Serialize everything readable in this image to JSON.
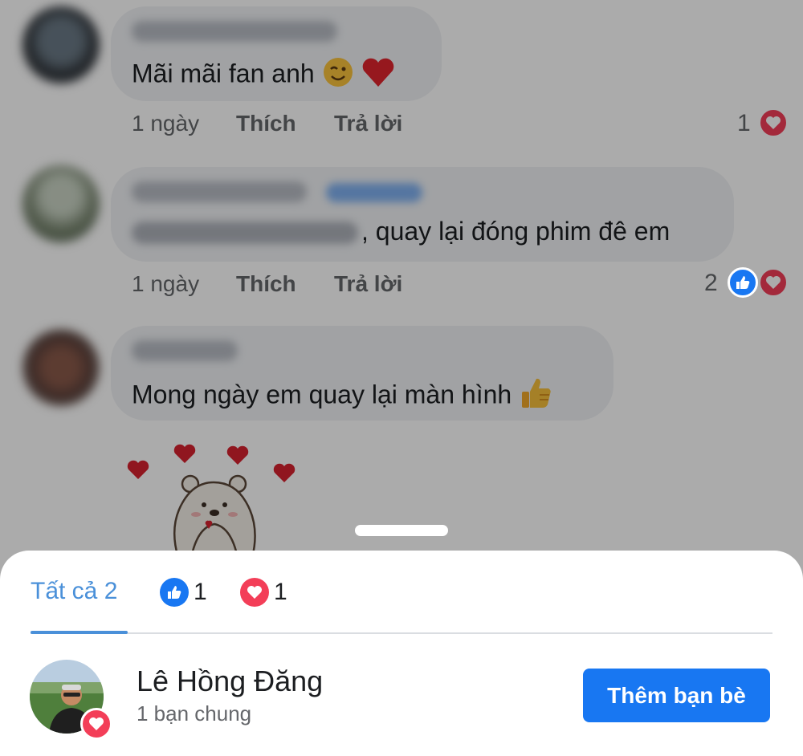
{
  "comments": [
    {
      "text": "Mãi mãi fan anh",
      "emojis": [
        "wink-face",
        "red-heart"
      ],
      "time": "1 ngày",
      "like_label": "Thích",
      "reply_label": "Trả lời",
      "reaction_count": "1",
      "reactions": [
        "love"
      ]
    },
    {
      "text": ", quay lại đóng phim đê em",
      "time": "1 ngày",
      "like_label": "Thích",
      "reply_label": "Trả lời",
      "reaction_count": "2",
      "reactions": [
        "like",
        "love"
      ]
    },
    {
      "text": "Mong ngày em quay lại màn hình",
      "emojis": [
        "thumbs-up"
      ]
    }
  ],
  "reactions_sheet": {
    "tabs": [
      {
        "label": "Tất cả 2",
        "icon": null
      },
      {
        "label": "1",
        "icon": "like-icon"
      },
      {
        "label": "1",
        "icon": "love-icon"
      }
    ],
    "people": [
      {
        "name": "Lê Hồng Đăng",
        "mutual": "1 bạn chung",
        "reaction": "love-icon",
        "action_label": "Thêm bạn bè"
      }
    ]
  },
  "colors": {
    "accent_blue": "#1877f2",
    "tab_active": "#4a90d9",
    "love_red": "#f33e58",
    "bubble_gray": "#f0f2f5"
  }
}
